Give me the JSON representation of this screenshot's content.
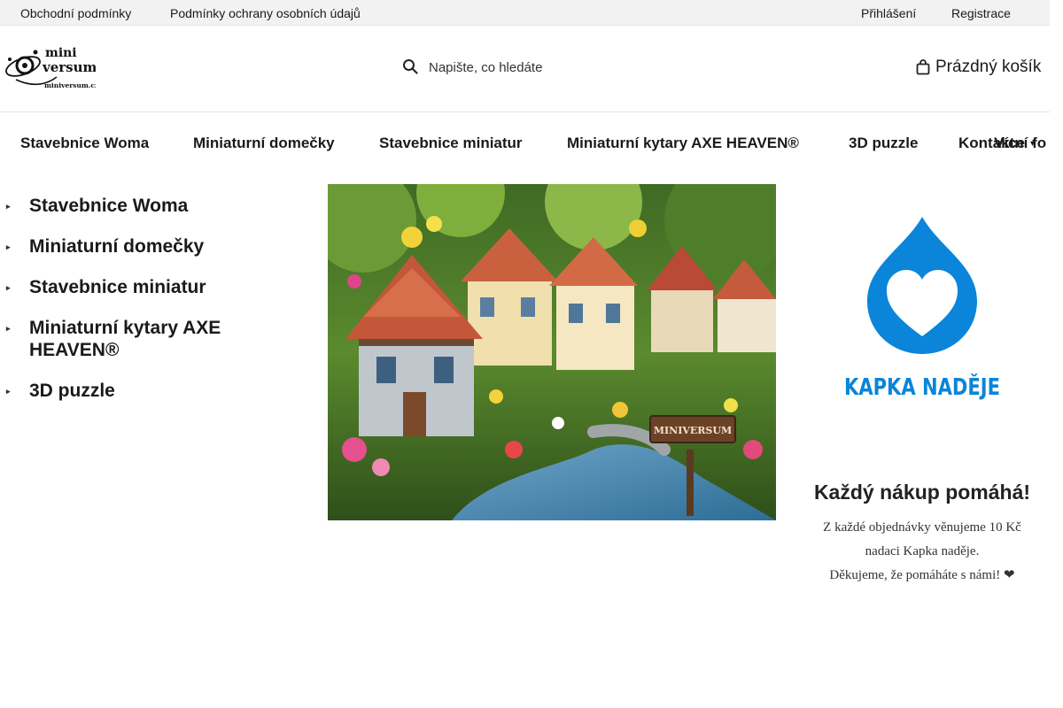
{
  "topbar": {
    "left_links": [
      "Obchodní podmínky",
      "Podmínky ochrany osobních údajů"
    ],
    "right_links": [
      "Přihlášení",
      "Registrace"
    ]
  },
  "header": {
    "logo_text": [
      "mini",
      "versum",
      "miniversum.cz"
    ],
    "search_placeholder": "Napište, co hledáte",
    "cart_label": "Prázdný košík"
  },
  "nav": {
    "items": [
      "Stavebnice Woma",
      "Miniaturní domečky",
      "Stavebnice miniatur",
      "Miniaturní kytary AXE HEAVEN®",
      "3D puzzle",
      "Kontaktní fo"
    ],
    "more_label": "Více"
  },
  "sidebar": {
    "categories": [
      "Stavebnice Woma",
      "Miniaturní domečky",
      "Stavebnice miniatur",
      "Miniaturní kytary AXE HEAVEN®",
      "3D puzzle"
    ]
  },
  "banner": {
    "sign_text": "MINIVERSUM"
  },
  "charity": {
    "logo_text": "KAPKA NADĚJE",
    "heading": "Každý nákup pomáhá!",
    "line1": "Z každé objednávky věnujeme 10 Kč nadaci Kapka naděje.",
    "line2": "Děkujeme, že pomáháte s námi! ❤"
  },
  "colors": {
    "charity_blue": "#0a85d9",
    "topbar_bg": "#f2f2f2"
  }
}
